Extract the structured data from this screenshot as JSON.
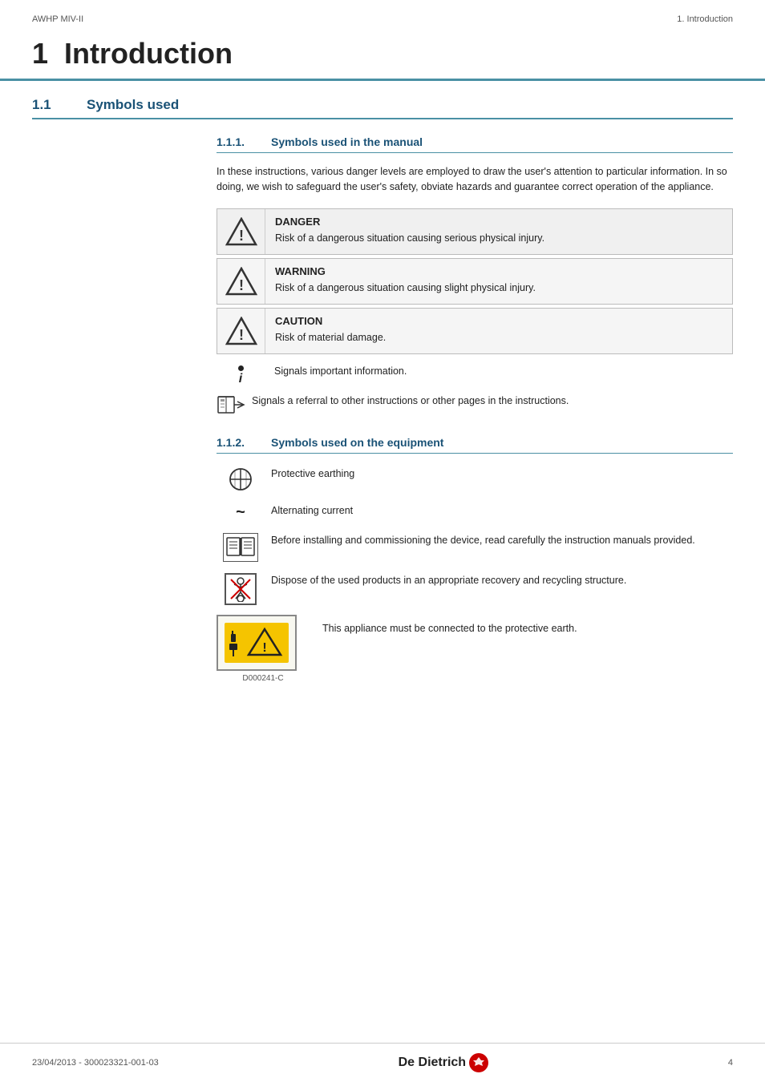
{
  "header": {
    "left": "AWHP MIV-II",
    "right": "1. Introduction"
  },
  "chapter": {
    "number": "1",
    "title": "Introduction"
  },
  "section1_1": {
    "number": "1.1",
    "title": "Symbols used"
  },
  "subsection1_1_1": {
    "number": "1.1.1.",
    "title": "Symbols used in the manual"
  },
  "intro_paragraph": "In these instructions, various danger levels are employed to draw the user's attention to particular information. In so doing, we wish to safeguard the user's safety, obviate hazards and guarantee correct operation of the appliance.",
  "danger_box": {
    "label": "DANGER",
    "description": "Risk of a dangerous situation causing serious physical injury."
  },
  "warning_box": {
    "label": "WARNING",
    "description": "Risk of a dangerous situation causing slight physical injury."
  },
  "caution_box": {
    "label": "CAUTION",
    "description": "Risk of material damage."
  },
  "info_box": {
    "description": "Signals important information."
  },
  "referral_text": "Signals a referral to other instructions or other pages in the instructions.",
  "subsection1_1_2": {
    "number": "1.1.2.",
    "title": "Symbols used on the equipment"
  },
  "equipment_items": [
    {
      "symbol": "⊕",
      "type": "earth",
      "description": "Protective earthing"
    },
    {
      "symbol": "~",
      "type": "tilde",
      "description": "Alternating current"
    },
    {
      "symbol": "book",
      "type": "book",
      "description": "Before installing and commissioning the device, read carefully the instruction manuals provided."
    },
    {
      "symbol": "recycle",
      "type": "recycle",
      "description": "Dispose of the used products in an appropriate recovery and recycling structure."
    }
  ],
  "label_block": {
    "caption": "D000241-C",
    "description": "This appliance must be connected to the protective earth."
  },
  "footer": {
    "left": "23/04/2013 - 300023321-001-03",
    "brand": "De Dietrich",
    "page_number": "4"
  }
}
